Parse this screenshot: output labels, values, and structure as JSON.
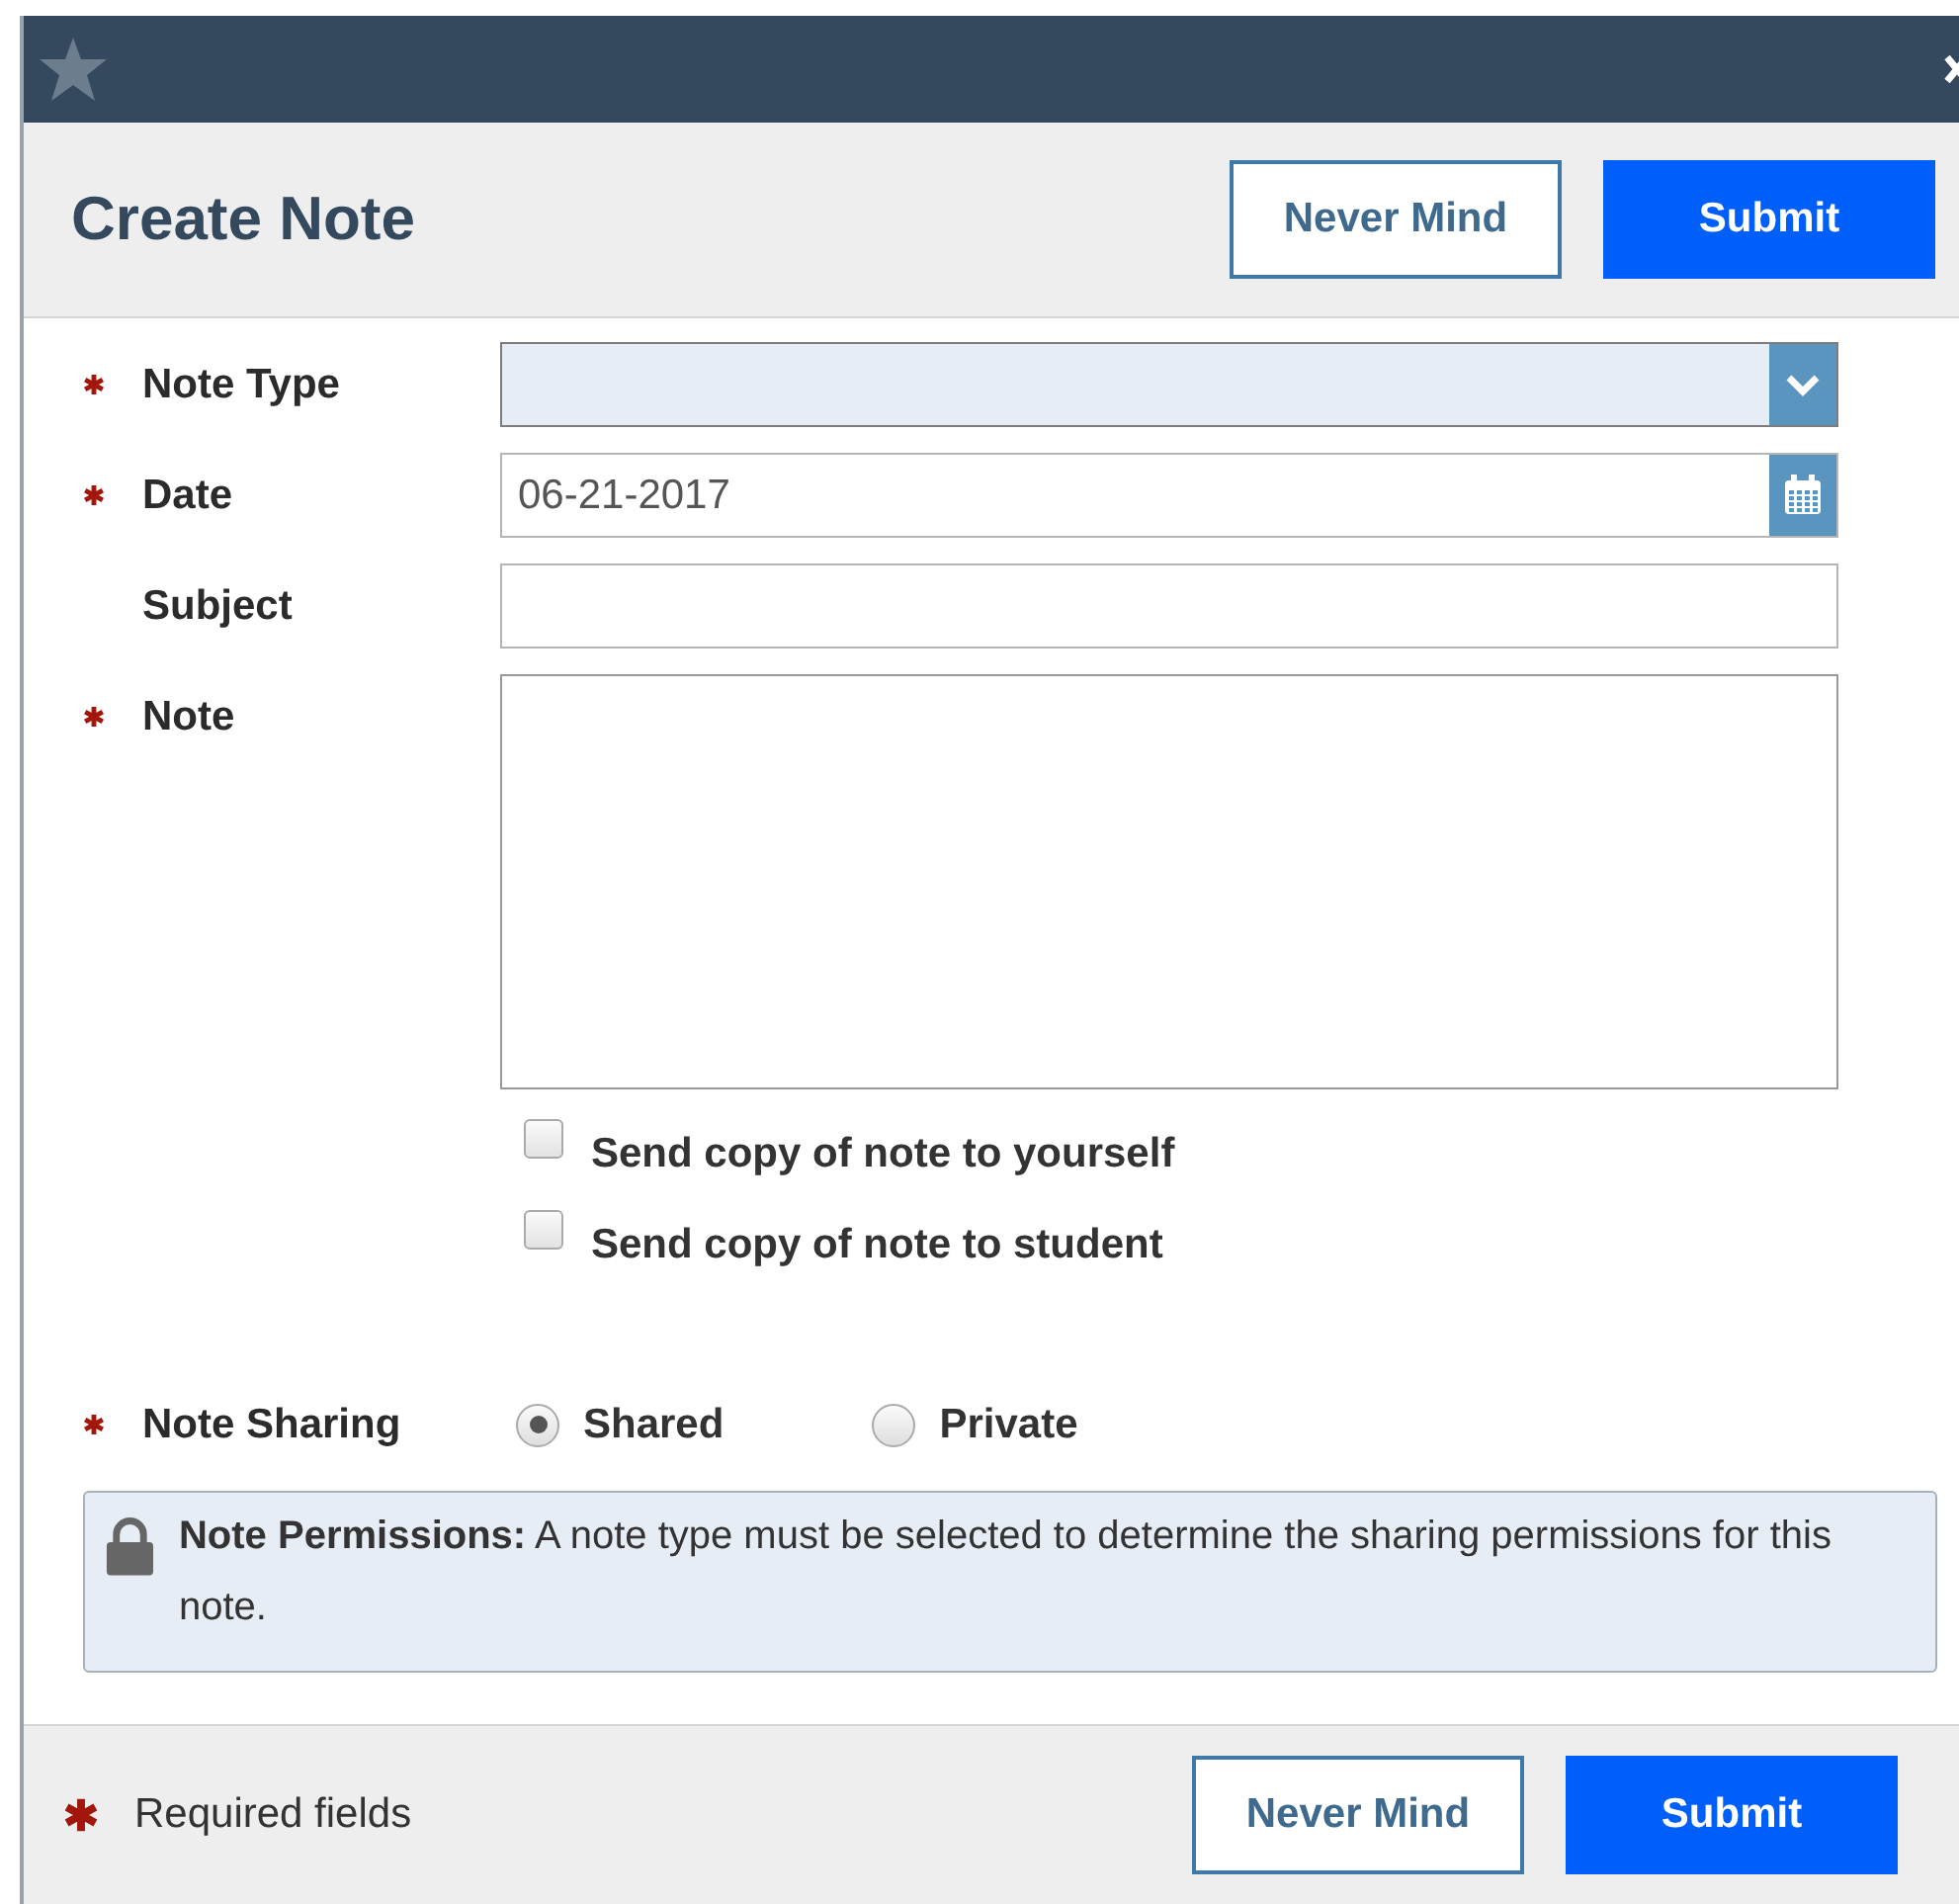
{
  "dialog": {
    "title": "Create Note",
    "header_buttons": [
      {
        "label": "Never Mind",
        "kind": "secondary"
      },
      {
        "label": "Submit",
        "kind": "primary"
      }
    ]
  },
  "fields": [
    {
      "label": "Note Type",
      "required": true,
      "kind": "select"
    },
    {
      "label": "Date",
      "required": true,
      "kind": "date",
      "value": "06-21-2017"
    },
    {
      "label": "Subject",
      "required": false,
      "kind": "text"
    },
    {
      "label": "Note",
      "required": true,
      "kind": "textarea"
    }
  ],
  "checkboxes": [
    {
      "label": "Send copy of note to yourself",
      "checked": false
    },
    {
      "label": "Send copy of note to student",
      "checked": false
    }
  ],
  "sharing": {
    "label": "Note Sharing",
    "required": true,
    "options": [
      {
        "label": "Shared",
        "selected": true
      },
      {
        "label": "Private",
        "selected": false
      }
    ]
  },
  "permissions": {
    "text": "**Note Permissions:** A note type must be selected to determine the sharing permissions for this note."
  },
  "footer": {
    "note": "Required fields",
    "buttons": [
      {
        "label": "Never Mind",
        "kind": "secondary"
      },
      {
        "label": "Submit",
        "kind": "primary"
      }
    ]
  }
}
